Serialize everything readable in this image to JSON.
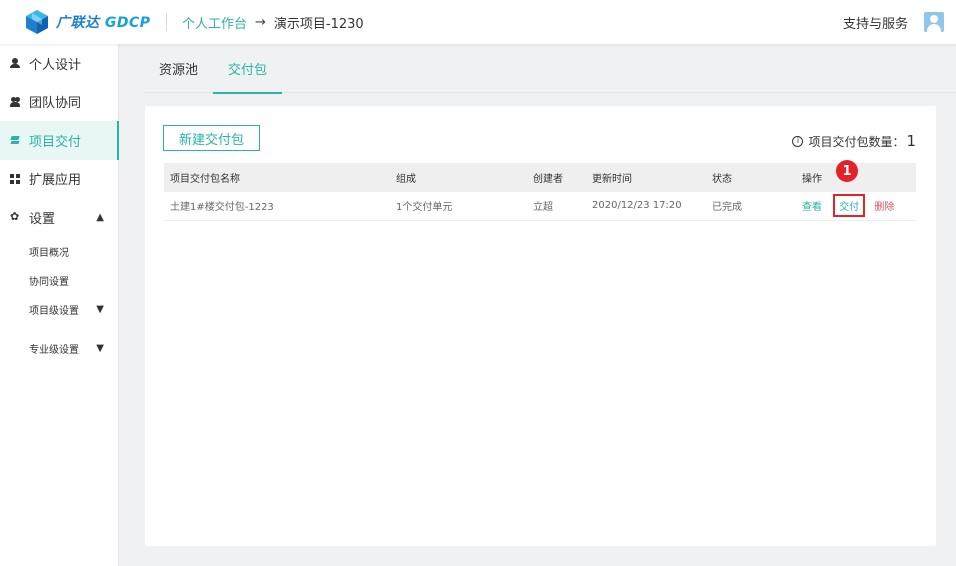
{
  "header": {
    "brand_cn": "广联达",
    "brand_en": "GDCP",
    "breadcrumb_link": "个人工作台",
    "breadcrumb_arrow": "→",
    "breadcrumb_current": "演示项目-1230",
    "support": "支持与服务"
  },
  "sidebar": {
    "items": [
      {
        "label": "个人设计",
        "icon": "user-icon"
      },
      {
        "label": "团队协同",
        "icon": "team-icon"
      },
      {
        "label": "项目交付",
        "icon": "layers-icon"
      },
      {
        "label": "扩展应用",
        "icon": "grid-icon"
      },
      {
        "label": "设置",
        "icon": "gear-icon"
      }
    ],
    "sub_items": [
      "项目概况",
      "协同设置",
      "项目级设置",
      "专业级设置"
    ]
  },
  "tabs": [
    "资源池",
    "交付包"
  ],
  "card": {
    "new_button": "新建交付包",
    "count_label": "项目交付包数量：",
    "count_value": "1",
    "columns": [
      "项目交付包名称",
      "组成",
      "创建者",
      "更新时间",
      "状态",
      "操作"
    ],
    "rows": [
      {
        "name": "土建1#楼交付包-1223",
        "composition": "1个交付单元",
        "creator": "立超",
        "updated": "2020/12/23 17:20",
        "status": "已完成",
        "actions": [
          "查看",
          "交付",
          "删除"
        ]
      }
    ]
  },
  "annotation": "1",
  "colors": {
    "accent": "#2ab3a6",
    "highlight": "#e3232a",
    "danger": "#e3505a"
  }
}
